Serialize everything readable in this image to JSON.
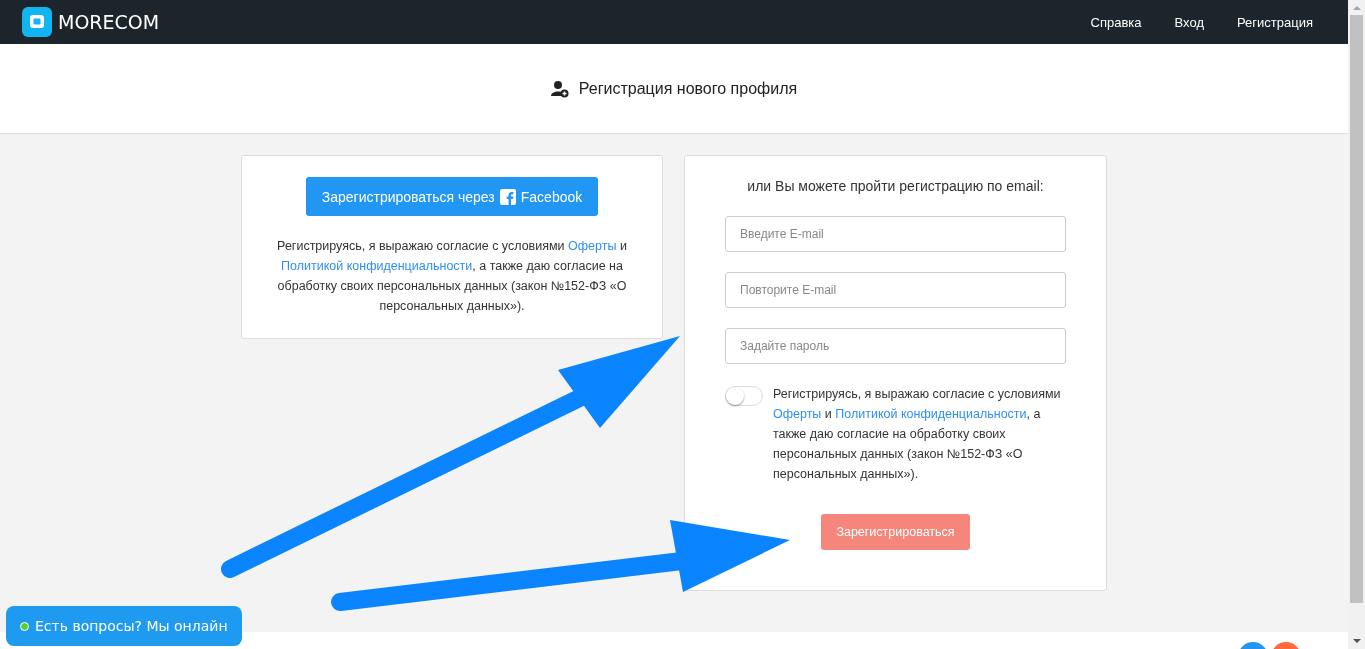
{
  "navbar": {
    "brand": "MORECOM",
    "links": [
      "Справка",
      "Вход",
      "Регистрация"
    ]
  },
  "page_title": "Регистрация нового профиля",
  "social_card": {
    "button": {
      "label_before": "Зарегистрироваться через",
      "label_after": "Facebook"
    },
    "consent": [
      {
        "text": "Регистрируясь, я выражаю согласие с условиями ",
        "link": false
      },
      {
        "text": "Оферты",
        "link": true
      },
      {
        "text": " и ",
        "link": false
      },
      {
        "text": "Политикой конфиденциальности",
        "link": true
      },
      {
        "text": ", а также даю согласие на обработку своих персональных данных (закон №152-ФЗ «О персональных данных»).",
        "link": false
      }
    ]
  },
  "email_card": {
    "heading": "или Вы можете пройти регистрацию по email:",
    "fields": [
      {
        "placeholder": "Введите E-mail"
      },
      {
        "placeholder": "Повторите E-mail"
      },
      {
        "placeholder": "Задайте пароль"
      }
    ],
    "toggle": {
      "on": false
    },
    "consent": [
      {
        "text": "Регистрируясь, я выражаю согласие с условиями ",
        "link": false
      },
      {
        "text": "Оферты",
        "link": true
      },
      {
        "text": " и ",
        "link": false
      },
      {
        "text": "Политикой конфиденциальности",
        "link": true
      },
      {
        "text": ", а также даю согласие на обработку своих персональных данных (закон №152-ФЗ «О персональных данных»).",
        "link": false
      }
    ],
    "submit": {
      "label": "Зарегистрироваться",
      "disabled": true
    }
  },
  "chat": {
    "label": "Есть вопросы? Мы онлайн",
    "online": true
  }
}
